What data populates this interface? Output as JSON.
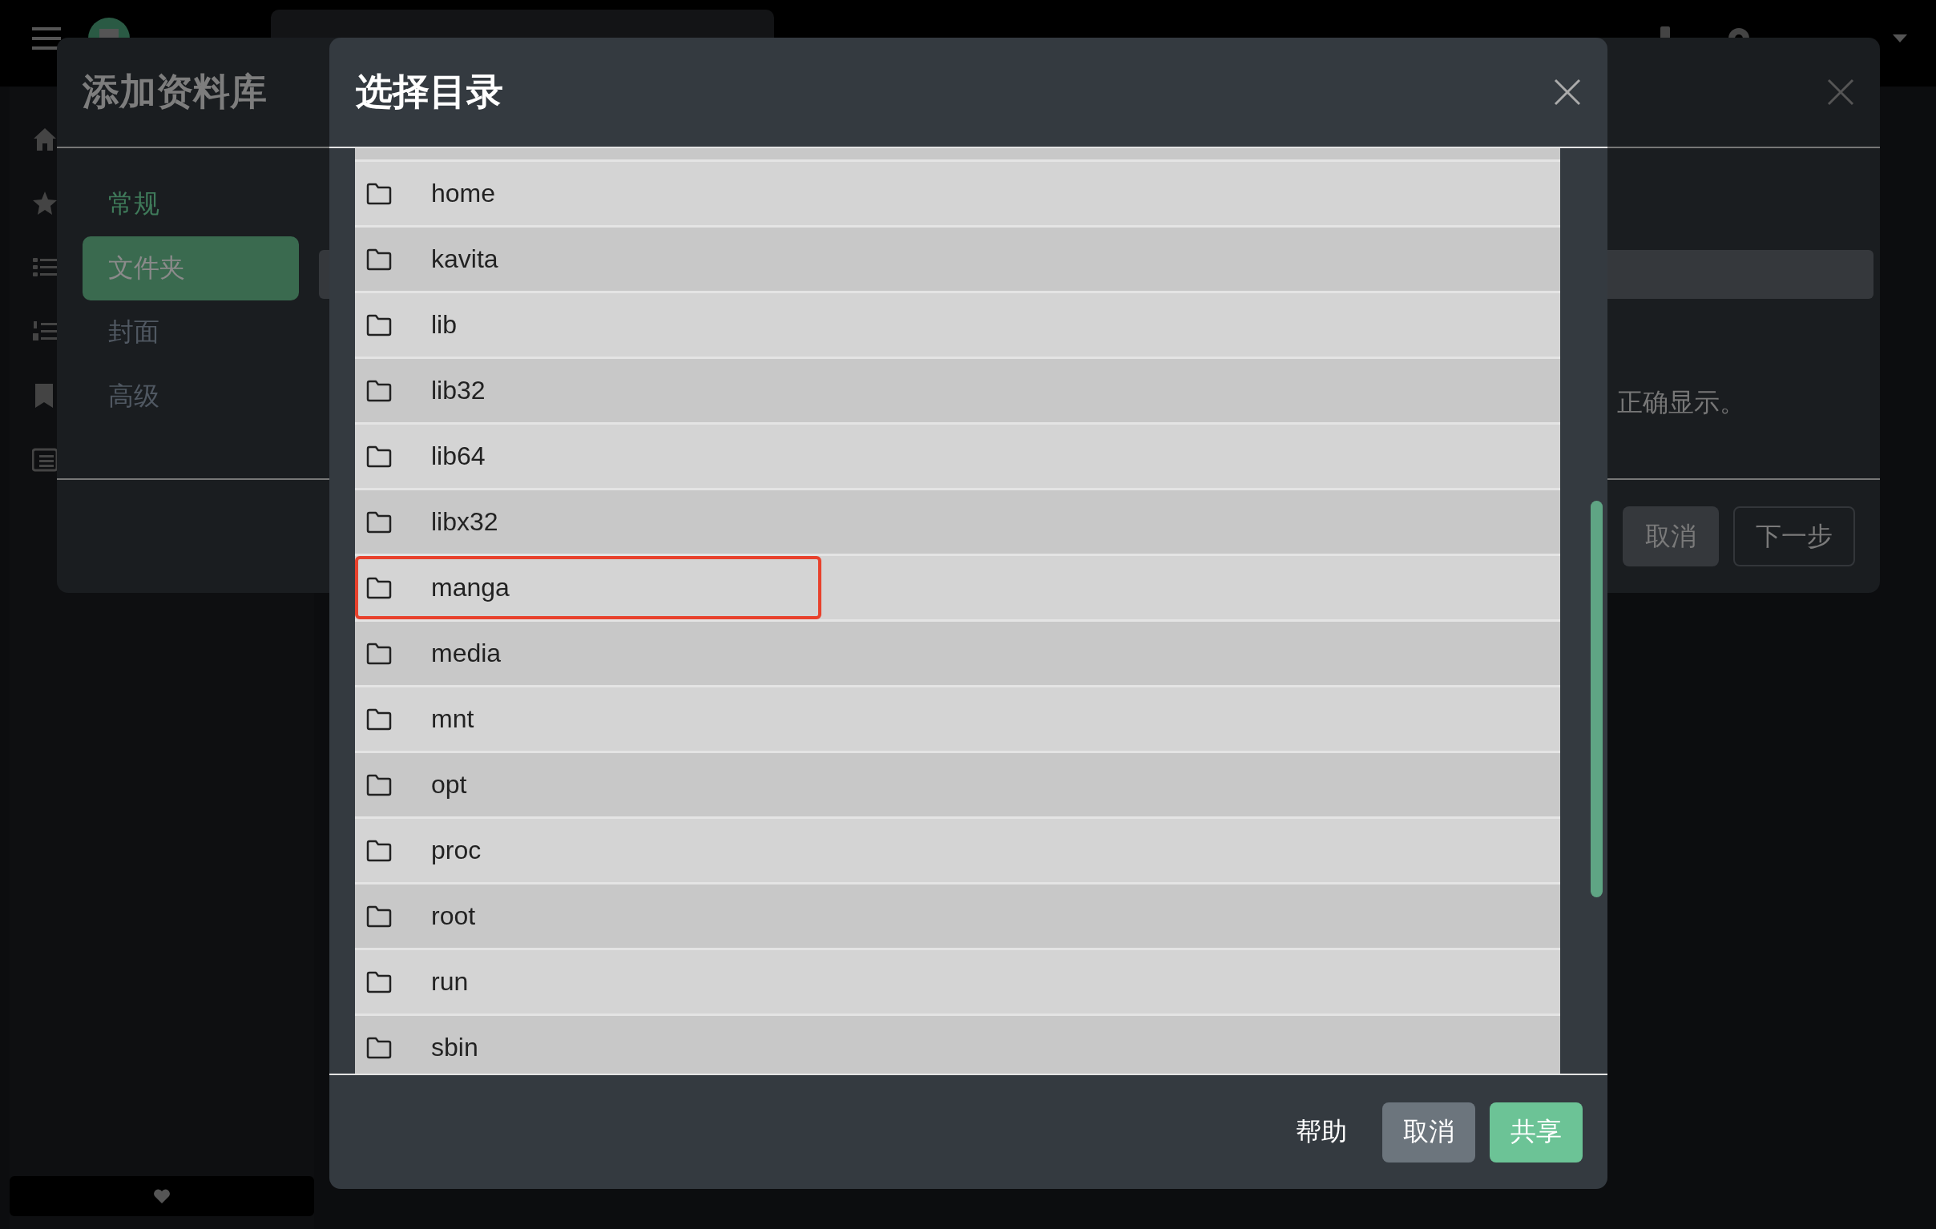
{
  "library_modal": {
    "title": "添加资料库",
    "tabs": [
      {
        "label": "常规",
        "selected": false,
        "disabled": false
      },
      {
        "label": "文件夹",
        "selected": true,
        "disabled": false
      },
      {
        "label": "封面",
        "selected": false,
        "disabled": true
      },
      {
        "label": "高级",
        "selected": false,
        "disabled": true
      }
    ],
    "note": "正确显示。",
    "buttons": [
      {
        "label": "取消",
        "kind": "secondary"
      },
      {
        "label": "下一步",
        "kind": "outline"
      }
    ]
  },
  "directory_dialog": {
    "title": "选择目录",
    "folders": [
      {
        "name": "home",
        "highlighted": false
      },
      {
        "name": "kavita",
        "highlighted": false
      },
      {
        "name": "lib",
        "highlighted": false
      },
      {
        "name": "lib32",
        "highlighted": false
      },
      {
        "name": "lib64",
        "highlighted": false
      },
      {
        "name": "libx32",
        "highlighted": false
      },
      {
        "name": "manga",
        "highlighted": true
      },
      {
        "name": "media",
        "highlighted": false
      },
      {
        "name": "mnt",
        "highlighted": false
      },
      {
        "name": "opt",
        "highlighted": false
      },
      {
        "name": "proc",
        "highlighted": false
      },
      {
        "name": "root",
        "highlighted": false
      },
      {
        "name": "run",
        "highlighted": false
      },
      {
        "name": "sbin",
        "highlighted": false
      }
    ],
    "buttons": [
      {
        "label": "帮助",
        "kind": "link"
      },
      {
        "label": "取消",
        "kind": "secondary"
      },
      {
        "label": "共享",
        "kind": "primary"
      }
    ]
  }
}
